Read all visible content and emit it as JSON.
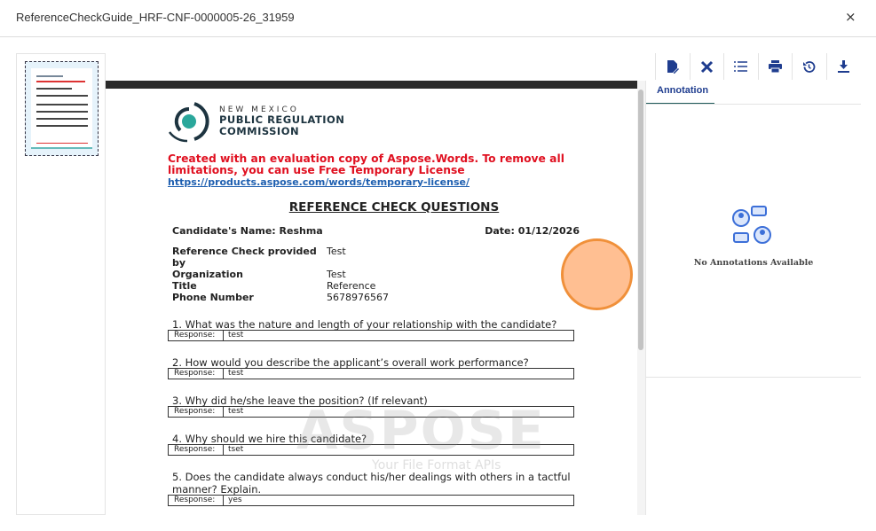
{
  "window": {
    "title": "ReferenceCheckGuide_HRF-CNF-0000005-26_31959",
    "close": "×"
  },
  "toolbar": {
    "icons": [
      "edit-document-icon",
      "tools-icon",
      "list-icon",
      "print-icon",
      "history-icon",
      "download-icon"
    ]
  },
  "document": {
    "logo": {
      "small": "NEW MEXICO",
      "line1": "PUBLIC REGULATION",
      "line2": "COMMISSION"
    },
    "evaluation_notice": "Created with an evaluation copy of Aspose.Words. To remove all limitations, you can use Free Temporary License",
    "license_link": "https://products.aspose.com/words/temporary-license/",
    "heading": "REFERENCE CHECK QUESTIONS",
    "candidate": "Candidate's Name: Reshma",
    "date": "Date: 01/12/2026",
    "info": [
      {
        "label": "Reference Check provided by",
        "value": "Test"
      },
      {
        "label": "Organization",
        "value": "Test"
      },
      {
        "label": "Title",
        "value": "Reference"
      },
      {
        "label": "Phone Number",
        "value": "5678976567"
      }
    ],
    "response_label": "Response:",
    "questions": [
      {
        "q": "1. What was the nature and length of your relationship with the candidate?",
        "a": "test"
      },
      {
        "q": "2. How would you describe the applicant’s overall work performance?",
        "a": "test"
      },
      {
        "q": "3. Why did he/she leave the position? (If relevant)",
        "a": "test"
      },
      {
        "q": "4. Why should we hire this candidate?",
        "a": "tset"
      },
      {
        "q": "5. Does the candidate always conduct his/her dealings with others in a tactful manner? Explain.",
        "a": "yes"
      }
    ],
    "watermark": "ASPOSE",
    "watermark_sub": "Your File Format APIs"
  },
  "annotation": {
    "tab": "Annotation",
    "empty": "No Annotations Available"
  },
  "colors": {
    "accent": "#1f3d8f",
    "tab_underline": "#1f5a5a",
    "eval_red": "#e01020"
  }
}
